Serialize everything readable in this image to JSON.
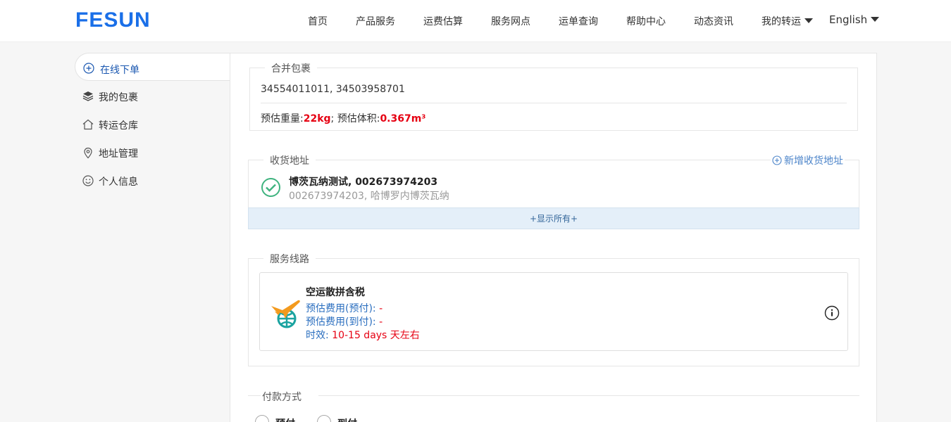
{
  "header": {
    "logo": "FESUN",
    "nav": [
      "首页",
      "产品服务",
      "运费估算",
      "服务网点",
      "运单查询",
      "帮助中心",
      "动态资讯"
    ],
    "my_transship": "我的转运",
    "language": "English"
  },
  "sidebar": {
    "items": [
      {
        "label": "在线下单",
        "icon": "plus-circle-icon",
        "active": true
      },
      {
        "label": "我的包裹",
        "icon": "layers-icon"
      },
      {
        "label": "转运仓库",
        "icon": "home-icon"
      },
      {
        "label": "地址管理",
        "icon": "location-pin-icon"
      },
      {
        "label": "个人信息",
        "icon": "smiley-icon"
      }
    ]
  },
  "merge": {
    "legend": "合并包裹",
    "package_ids": "34554011011, 34503958701",
    "weight_label": "预估重量:",
    "weight_value": "22kg",
    "sep": "; ",
    "volume_label": "预估体积:",
    "volume_value": "0.367m³"
  },
  "address": {
    "legend": "收货地址",
    "add_label": "新增收货地址",
    "selected_name": "博茨瓦纳测试, 002673974203",
    "selected_detail": "002673974203, 哈博罗内博茨瓦纳",
    "show_all": "+显示所有+"
  },
  "service": {
    "legend": "服务线路",
    "route_name": "空运散拼含税",
    "prepaid_label": "预估费用(预付):",
    "prepaid_value": "-",
    "collect_label": "预估费用(到付):",
    "collect_value": "-",
    "time_label": "时效:",
    "time_value": "10-15 days 天左右"
  },
  "payment": {
    "legend": "付款方式",
    "options": [
      "预付",
      "到付"
    ]
  },
  "colors": {
    "brand": "#1a6fe8",
    "price_red": "#e60012",
    "link_blue": "#4a83c9",
    "success_green": "#3fb37f"
  }
}
